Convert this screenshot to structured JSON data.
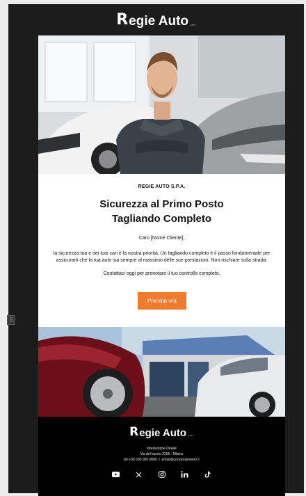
{
  "brand": {
    "initial": "R",
    "name": "egie Auto",
    "tagline": "cars"
  },
  "email": {
    "company": "REGIE AUTO S.P.A.",
    "headline_line1": "Sicurezza al Primo Posto",
    "headline_line2": "Tagliando Completo",
    "greeting": "Caro [Nome Cliente],",
    "body_line1": "la sicurezza tua e dei tuoi cari è la nostra priorità. Un tagliando completo è il passo fondamentale per",
    "body_line2": "assicurarti che la tua auto sia sempre al massimo delle sue prestazioni. Non rischiare sulla strada.",
    "cta_text": "Contattaci oggi per prenotare il tuo controllo completo.",
    "cta_label": "Prenota ora"
  },
  "footer": {
    "dealer_header": "Intestazione Dealer",
    "address": "Via del lavoro 2255 - Milano",
    "phone": "ph +39 000 000 0000",
    "separator": "|",
    "email": "email@concessionario.it",
    "socials": [
      "youtube-icon",
      "x-icon",
      "instagram-icon",
      "linkedin-icon",
      "tiktok-icon"
    ]
  },
  "colors": {
    "accent": "#f07a2e",
    "background": "#1c1c1c",
    "footer": "#000000"
  },
  "side_handle": "⌷"
}
